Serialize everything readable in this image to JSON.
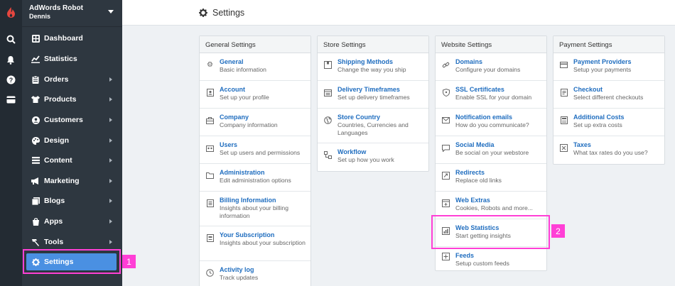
{
  "account": {
    "name": "AdWords Robot",
    "user": "Dennis"
  },
  "rail": {
    "icons": [
      "logo-icon",
      "search-icon",
      "bell-icon",
      "help-icon",
      "billing-icon"
    ]
  },
  "nav": [
    {
      "label": "Dashboard",
      "icon": "dashboard-icon",
      "arrow": false
    },
    {
      "label": "Statistics",
      "icon": "statistics-icon",
      "arrow": false
    },
    {
      "label": "Orders",
      "icon": "orders-icon",
      "arrow": true
    },
    {
      "label": "Products",
      "icon": "products-icon",
      "arrow": true
    },
    {
      "label": "Customers",
      "icon": "customers-icon",
      "arrow": true
    },
    {
      "label": "Design",
      "icon": "design-icon",
      "arrow": true
    },
    {
      "label": "Content",
      "icon": "content-icon",
      "arrow": true
    },
    {
      "label": "Marketing",
      "icon": "marketing-icon",
      "arrow": true
    },
    {
      "label": "Blogs",
      "icon": "blogs-icon",
      "arrow": true
    },
    {
      "label": "Apps",
      "icon": "apps-icon",
      "arrow": true
    },
    {
      "label": "Tools",
      "icon": "tools-icon",
      "arrow": true
    },
    {
      "label": "Settings",
      "icon": "gear-icon",
      "arrow": false,
      "active": true
    }
  ],
  "header": {
    "title": "Settings"
  },
  "annotations": {
    "first": "1",
    "second": "2"
  },
  "colors": {
    "accent": "#4a90e2",
    "link": "#1f6dbf",
    "highlight": "#ff3fd6",
    "sidebar": "#2e3740"
  },
  "columns": [
    {
      "title": "General Settings",
      "items": [
        {
          "title": "General",
          "desc": "Basic information",
          "icon": "gear-icon"
        },
        {
          "title": "Account",
          "desc": "Set up your profile",
          "icon": "account-icon"
        },
        {
          "title": "Company",
          "desc": "Company information",
          "icon": "briefcase-icon"
        },
        {
          "title": "Users",
          "desc": "Set up users and permissions",
          "icon": "users-icon"
        },
        {
          "title": "Administration",
          "desc": "Edit administration options",
          "icon": "folder-icon"
        },
        {
          "title": "Billing Information",
          "desc": "Insights about your billing information",
          "icon": "billing-icon"
        },
        {
          "title": "Your Subscription",
          "desc": "Insights about your subscription",
          "icon": "subscription-icon"
        },
        {
          "title": "Activity log",
          "desc": "Track updates",
          "icon": "clock-icon"
        }
      ]
    },
    {
      "title": "Store Settings",
      "items": [
        {
          "title": "Shipping Methods",
          "desc": "Change the way you ship",
          "icon": "shipping-icon"
        },
        {
          "title": "Delivery Timeframes",
          "desc": "Set up delivery timeframes",
          "icon": "calendar-icon"
        },
        {
          "title": "Store Country",
          "desc": "Countries, Currencies and Languages",
          "icon": "globe-icon"
        },
        {
          "title": "Workflow",
          "desc": "Set up how you work",
          "icon": "workflow-icon"
        }
      ]
    },
    {
      "title": "Website Settings",
      "items": [
        {
          "title": "Domains",
          "desc": "Configure your domains",
          "icon": "link-icon"
        },
        {
          "title": "SSL Certificates",
          "desc": "Enable SSL for your domain",
          "icon": "shield-icon"
        },
        {
          "title": "Notification emails",
          "desc": "How do you communicate?",
          "icon": "mail-icon"
        },
        {
          "title": "Social Media",
          "desc": "Be social on your webstore",
          "icon": "chat-icon"
        },
        {
          "title": "Redirects",
          "desc": "Replace old links",
          "icon": "redirect-icon"
        },
        {
          "title": "Web Extras",
          "desc": "Cookies, Robots and more...",
          "icon": "web-extras-icon"
        },
        {
          "title": "Web Statistics",
          "desc": "Start getting insights",
          "icon": "chart-icon"
        },
        {
          "title": "Feeds",
          "desc": "Setup custom feeds",
          "icon": "feed-icon"
        }
      ]
    },
    {
      "title": "Payment Settings",
      "items": [
        {
          "title": "Payment Providers",
          "desc": "Setup your payments",
          "icon": "credit-card-icon"
        },
        {
          "title": "Checkout",
          "desc": "Select different checkouts",
          "icon": "checkout-icon"
        },
        {
          "title": "Additional Costs",
          "desc": "Set up extra costs",
          "icon": "calculator-icon"
        },
        {
          "title": "Taxes",
          "desc": "What tax rates do you use?",
          "icon": "tax-icon"
        }
      ]
    }
  ]
}
